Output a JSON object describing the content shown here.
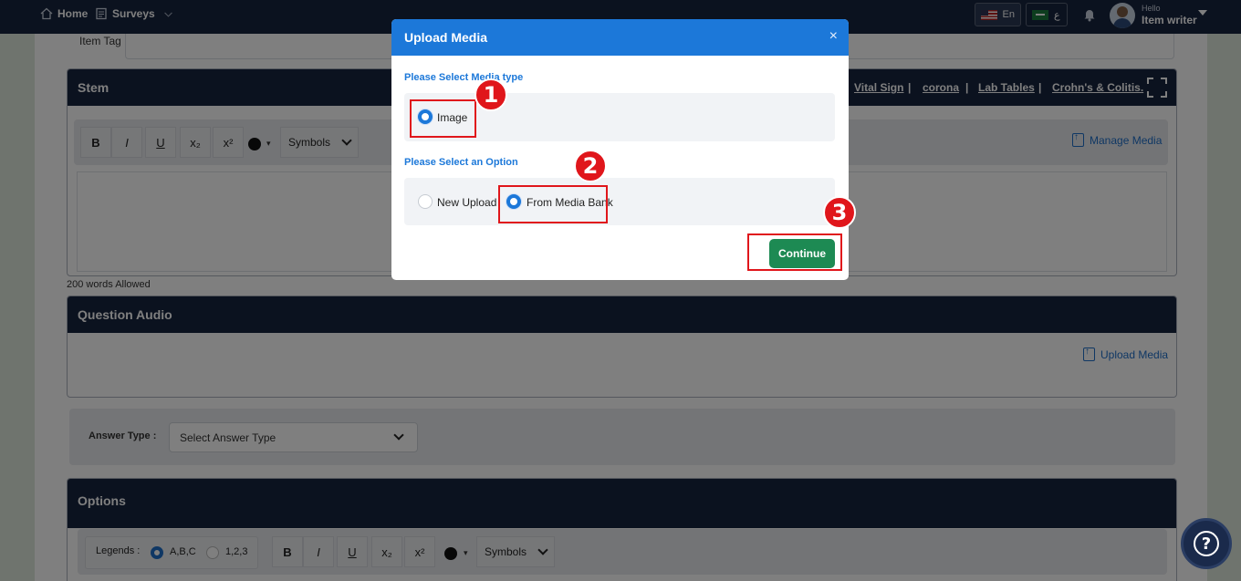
{
  "topbar": {
    "home_label": "Home",
    "surveys_label": "Surveys",
    "lang_en": "En",
    "lang_ar": "ع",
    "user_greeting": "Hello",
    "user_name": "Item writer"
  },
  "form": {
    "item_tag_label": "Item Tag",
    "stem_title": "Stem",
    "stem_links": [
      "Vital Sign",
      "corona",
      "Lab Tables",
      "Crohn's & Colitis."
    ],
    "stem_sep": "|",
    "toolbar": {
      "bold": "B",
      "italic": "I",
      "underline": "U",
      "subscript": "x₂",
      "superscript": "x²",
      "caret": "▾",
      "symbols": "Symbols"
    },
    "manage_media": "Manage Media",
    "words_allowed": "200 words Allowed",
    "audio_title": "Question Audio",
    "upload_media": "Upload Media",
    "answer_type_label": "Answer Type :",
    "answer_type_value": "Select Answer Type",
    "options_title": "Options",
    "legends_label": "Legends :",
    "legend_abc": "A,B,C",
    "legend_123": "1,2,3",
    "legend_selected": "A,B,C"
  },
  "modal": {
    "title": "Upload Media",
    "close": "×",
    "media_type_title": "Please Select Media type",
    "media_type_option": "Image",
    "option_title": "Please Select an Option",
    "option_new_upload": "New Upload",
    "option_media_bank": "From Media Bank",
    "selected_option": "From Media Bank",
    "continue_label": "Continue"
  },
  "annotations": {
    "badge_1": "1",
    "badge_2": "2",
    "badge_3": "3"
  },
  "help": {
    "label": "?"
  },
  "colors": {
    "navy": "#17243f",
    "modal_blue": "#1c78d9",
    "continue_green": "#1d8a53",
    "highlight_red": "#e0161b",
    "link_blue": "#1f6fc9"
  }
}
